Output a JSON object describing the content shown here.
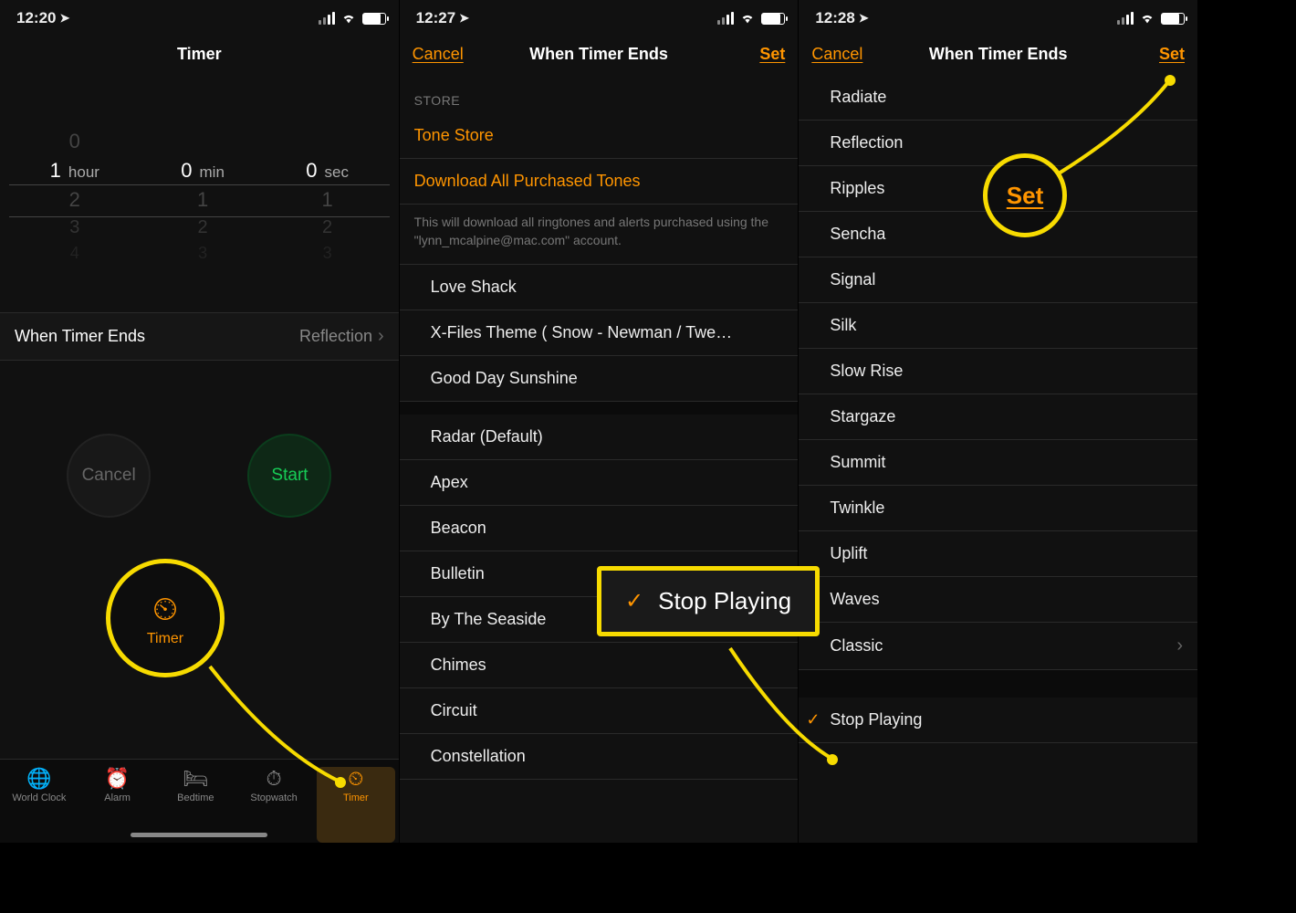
{
  "accent_color": "#ff9500",
  "highlight_color": "#f7db00",
  "screen1": {
    "status_time": "12:20",
    "title": "Timer",
    "picker": {
      "hour": {
        "above": "0",
        "sel": "1",
        "unit": "hour",
        "below1": "2",
        "below2": "3",
        "below3": "4"
      },
      "min": {
        "above": "",
        "sel": "0",
        "unit": "min",
        "below1": "1",
        "below2": "2",
        "below3": "3"
      },
      "sec": {
        "above": "",
        "sel": "0",
        "unit": "sec",
        "below1": "1",
        "below2": "2",
        "below3": "3"
      }
    },
    "when_ends_label": "When Timer Ends",
    "when_ends_value": "Reflection",
    "cancel_label": "Cancel",
    "start_label": "Start",
    "tabs": [
      "World Clock",
      "Alarm",
      "Bedtime",
      "Stopwatch",
      "Timer"
    ],
    "callout_label": "Timer"
  },
  "screen2": {
    "status_time": "12:27",
    "cancel": "Cancel",
    "title": "When Timer Ends",
    "set": "Set",
    "store_header": "STORE",
    "tone_store": "Tone Store",
    "download_all": "Download All Purchased Tones",
    "download_note": "This will download all ringtones and alerts purchased using the \"lynn_mcalpine@mac.com\" account.",
    "ringtones": [
      "Love Shack",
      "X-Files Theme ( Snow - Newman / Twe…",
      "Good Day Sunshine"
    ],
    "tones": [
      "Radar (Default)",
      "Apex",
      "Beacon",
      "Bulletin",
      "By The Seaside",
      "Chimes",
      "Circuit",
      "Constellation"
    ],
    "callout_label": "Stop Playing"
  },
  "screen3": {
    "status_time": "12:28",
    "cancel": "Cancel",
    "title": "When Timer Ends",
    "set": "Set",
    "tones": [
      "Radiate",
      "Reflection",
      "Ripples",
      "Sencha",
      "Signal",
      "Silk",
      "Slow Rise",
      "Stargaze",
      "Summit",
      "Twinkle",
      "Uplift",
      "Waves"
    ],
    "classic": "Classic",
    "stop_playing": "Stop Playing",
    "callout_set": "Set"
  }
}
